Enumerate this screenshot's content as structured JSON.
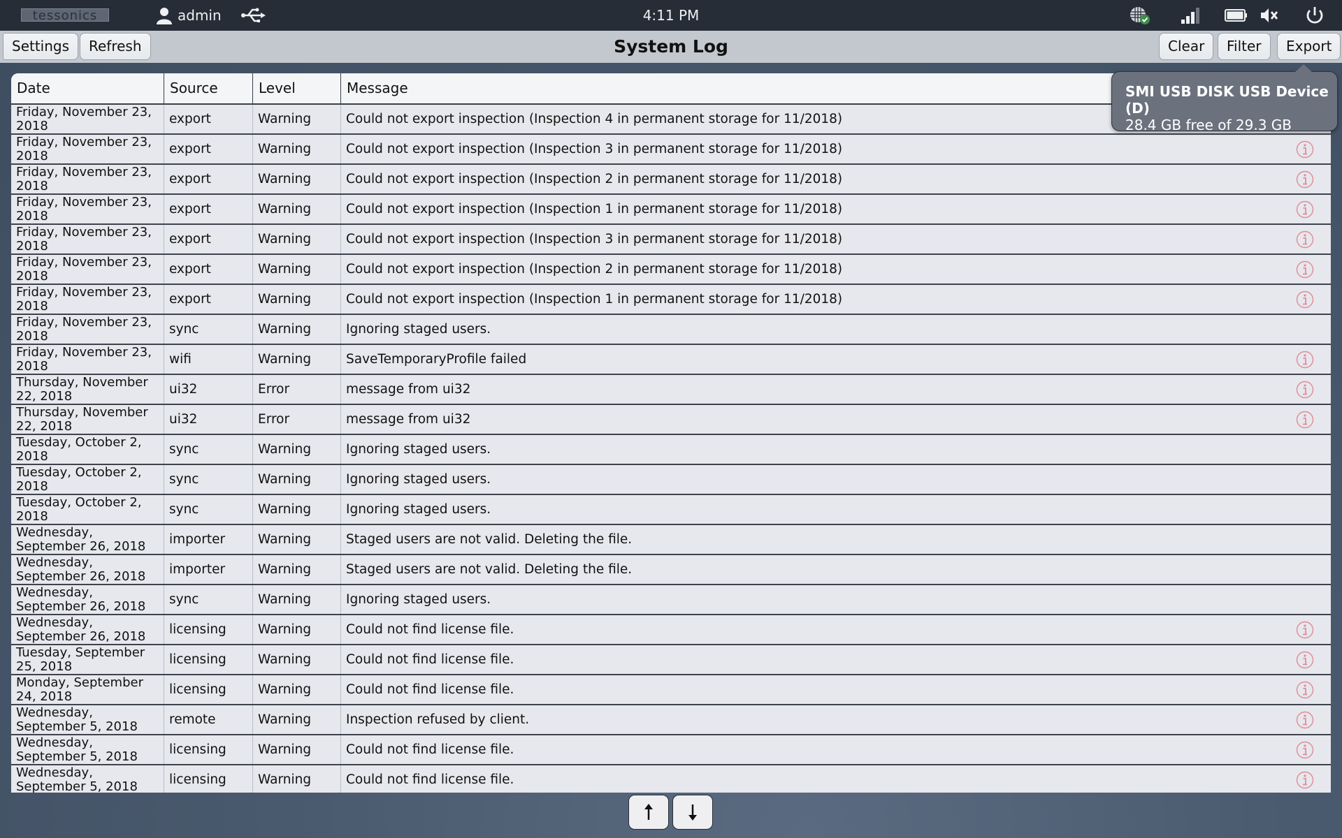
{
  "topbar": {
    "logo": "tessonics",
    "user": "admin",
    "clock": "4:11 PM",
    "icons": [
      "user-icon",
      "usb-icon",
      "network-connected-icon",
      "signal-icon",
      "battery-icon",
      "mute-icon",
      "power-icon"
    ]
  },
  "toolbar": {
    "settings_label": "Settings",
    "refresh_label": "Refresh",
    "title": "System Log",
    "clear_label": "Clear",
    "filter_label": "Filter",
    "export_label": "Export"
  },
  "tooltip": {
    "title": "SMI USB DISK USB Device (D)",
    "subtitle": "28.4 GB free of 29.3 GB"
  },
  "table": {
    "columns": [
      "Date",
      "Source",
      "Level",
      "Message"
    ],
    "rows": [
      {
        "date": "Friday, November 23, 2018",
        "source": "export",
        "level": "Warning",
        "message": "Could not export inspection (Inspection 4 in permanent storage for 11/2018)",
        "info": true
      },
      {
        "date": "Friday, November 23, 2018",
        "source": "export",
        "level": "Warning",
        "message": "Could not export inspection (Inspection 3 in permanent storage for 11/2018)",
        "info": true
      },
      {
        "date": "Friday, November 23, 2018",
        "source": "export",
        "level": "Warning",
        "message": "Could not export inspection (Inspection 2 in permanent storage for 11/2018)",
        "info": true
      },
      {
        "date": "Friday, November 23, 2018",
        "source": "export",
        "level": "Warning",
        "message": "Could not export inspection (Inspection 1 in permanent storage for 11/2018)",
        "info": true
      },
      {
        "date": "Friday, November 23, 2018",
        "source": "export",
        "level": "Warning",
        "message": "Could not export inspection (Inspection 3 in permanent storage for 11/2018)",
        "info": true
      },
      {
        "date": "Friday, November 23, 2018",
        "source": "export",
        "level": "Warning",
        "message": "Could not export inspection (Inspection 2 in permanent storage for 11/2018)",
        "info": true
      },
      {
        "date": "Friday, November 23, 2018",
        "source": "export",
        "level": "Warning",
        "message": "Could not export inspection (Inspection 1 in permanent storage for 11/2018)",
        "info": true
      },
      {
        "date": "Friday, November 23, 2018",
        "source": "sync",
        "level": "Warning",
        "message": "Ignoring staged users.",
        "info": false
      },
      {
        "date": "Friday, November 23, 2018",
        "source": "wifi",
        "level": "Warning",
        "message": "SaveTemporaryProfile failed",
        "info": true
      },
      {
        "date": "Thursday, November 22, 2018",
        "source": "ui32",
        "level": "Error",
        "message": "message from ui32",
        "info": true
      },
      {
        "date": "Thursday, November 22, 2018",
        "source": "ui32",
        "level": "Error",
        "message": "message from ui32",
        "info": true
      },
      {
        "date": "Tuesday, October 2, 2018",
        "source": "sync",
        "level": "Warning",
        "message": "Ignoring staged users.",
        "info": false
      },
      {
        "date": "Tuesday, October 2, 2018",
        "source": "sync",
        "level": "Warning",
        "message": "Ignoring staged users.",
        "info": false
      },
      {
        "date": "Tuesday, October 2, 2018",
        "source": "sync",
        "level": "Warning",
        "message": "Ignoring staged users.",
        "info": false
      },
      {
        "date": "Wednesday, September 26, 2018",
        "source": "importer",
        "level": "Warning",
        "message": "Staged users are not valid. Deleting the file.",
        "info": false
      },
      {
        "date": "Wednesday, September 26, 2018",
        "source": "importer",
        "level": "Warning",
        "message": "Staged users are not valid. Deleting the file.",
        "info": false
      },
      {
        "date": "Wednesday, September 26, 2018",
        "source": "sync",
        "level": "Warning",
        "message": "Ignoring staged users.",
        "info": false
      },
      {
        "date": "Wednesday, September 26, 2018",
        "source": "licensing",
        "level": "Warning",
        "message": "Could not find license file.",
        "info": true
      },
      {
        "date": "Tuesday, September 25, 2018",
        "source": "licensing",
        "level": "Warning",
        "message": "Could not find license file.",
        "info": true
      },
      {
        "date": "Monday, September 24, 2018",
        "source": "licensing",
        "level": "Warning",
        "message": "Could not find license file.",
        "info": true
      },
      {
        "date": "Wednesday, September 5, 2018",
        "source": "remote",
        "level": "Warning",
        "message": "Inspection refused by client.",
        "info": true
      },
      {
        "date": "Wednesday, September 5, 2018",
        "source": "licensing",
        "level": "Warning",
        "message": "Could not find license file.",
        "info": true
      },
      {
        "date": "Wednesday, September 5, 2018",
        "source": "licensing",
        "level": "Warning",
        "message": "Could not find license file.",
        "info": true
      }
    ]
  },
  "scroll": {
    "up_icon": "arrow-up-icon",
    "down_icon": "arrow-down-icon"
  },
  "colors": {
    "topbar": "#262d37",
    "toolbar": "#c3c8cf",
    "info_icon": "#e08c98",
    "network_ok": "#3e8e4a"
  }
}
